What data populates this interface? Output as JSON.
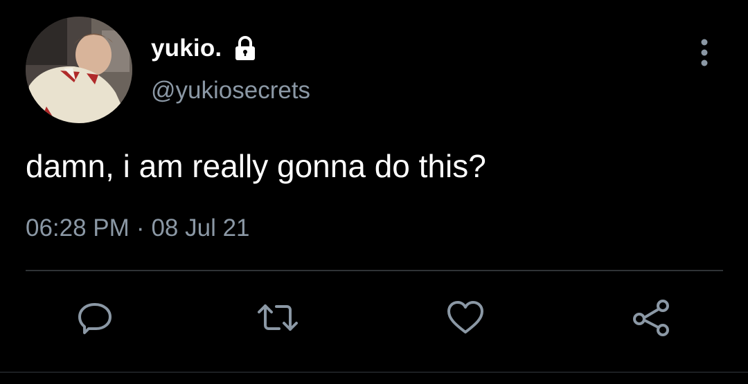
{
  "tweet": {
    "display_name": "yukio.",
    "handle": "@yukiosecrets",
    "text": "damn, i am really gonna do this?",
    "time": "06:28 PM",
    "separator": "·",
    "date": "08 Jul 21",
    "protected_account_icon": "lock-icon",
    "avatar_icon": "profile-photo"
  },
  "menu": {
    "icon": "more-vertical-icon"
  },
  "actions": [
    {
      "icon": "reply-icon"
    },
    {
      "icon": "retweet-icon"
    },
    {
      "icon": "like-icon"
    },
    {
      "icon": "share-icon"
    }
  ],
  "colors": {
    "background": "#000000",
    "primary_text": "#ffffff",
    "secondary_text": "#8b98a5",
    "divider": "#2f3336"
  }
}
